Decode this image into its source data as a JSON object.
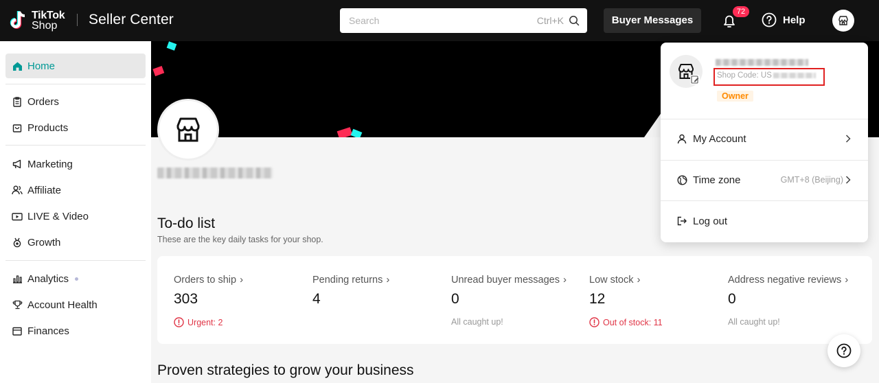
{
  "header": {
    "logo_line1": "TikTok",
    "logo_line2": "Shop",
    "app_title": "Seller Center",
    "search_placeholder": "Search",
    "search_shortcut": "Ctrl+K",
    "buyer_messages_label": "Buyer Messages",
    "notification_count": "72",
    "help_label": "Help",
    "accent_color": "#fe2c55"
  },
  "sidebar": {
    "items": [
      {
        "label": "Home",
        "icon": "home-icon",
        "active": true
      },
      {
        "label": "Orders",
        "icon": "clipboard-icon"
      },
      {
        "label": "Products",
        "icon": "bag-icon"
      },
      {
        "label": "Marketing",
        "icon": "megaphone-icon"
      },
      {
        "label": "Affiliate",
        "icon": "users-icon"
      },
      {
        "label": "LIVE & Video",
        "icon": "video-icon"
      },
      {
        "label": "Growth",
        "icon": "medal-icon"
      },
      {
        "label": "Analytics",
        "icon": "bar-chart-icon"
      },
      {
        "label": "Account Health",
        "icon": "trophy-icon"
      },
      {
        "label": "Finances",
        "icon": "wallet-icon"
      }
    ],
    "active_color": "#009995"
  },
  "todo": {
    "title": "To-do list",
    "subtitle": "These are the key daily tasks for your shop.",
    "metrics": [
      {
        "label": "Orders to ship",
        "value": "303",
        "note": "Urgent: 2",
        "note_type": "urgent"
      },
      {
        "label": "Pending returns",
        "value": "4",
        "note": "",
        "note_type": "none"
      },
      {
        "label": "Unread buyer messages",
        "value": "0",
        "note": "All caught up!",
        "note_type": "ok"
      },
      {
        "label": "Low stock",
        "value": "12",
        "note": "Out of stock: 11",
        "note_type": "urgent"
      },
      {
        "label": "Address negative reviews",
        "value": "0",
        "note": "All caught up!",
        "note_type": "ok"
      }
    ]
  },
  "growth": {
    "title": "Proven strategies to grow your business"
  },
  "account_menu": {
    "shop_code_label": "Shop Code: US",
    "role": "Owner",
    "my_account_label": "My Account",
    "time_zone_label": "Time zone",
    "time_zone_value": "GMT+8 (Beijing)",
    "logout_label": "Log out"
  }
}
